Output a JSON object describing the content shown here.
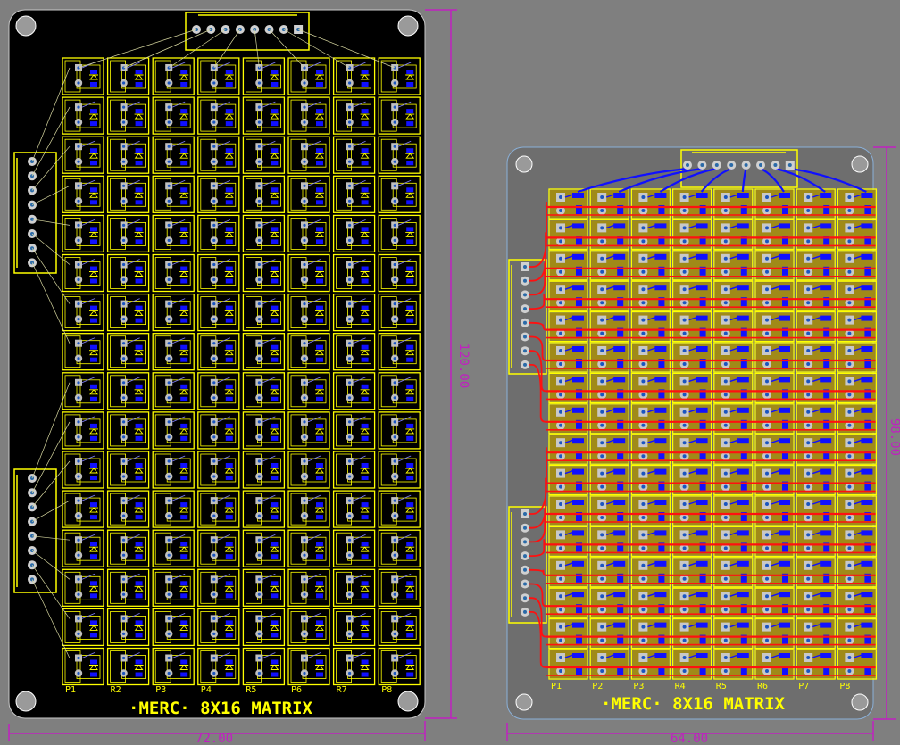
{
  "boards": [
    {
      "id": "left",
      "title": "·MERC· 8X16 MATRIX",
      "rows": 16,
      "cols": 8,
      "column_labels": [
        "P1",
        "R2",
        "P3",
        "P4",
        "R5",
        "P6",
        "R7",
        "P8"
      ],
      "width_dim_label": "72.00",
      "height_dim_label": "120.00",
      "view": "silkscreen + drill (routing hidden)"
    },
    {
      "id": "right",
      "title": "·MERC· 8X16 MATRIX",
      "rows": 16,
      "cols": 8,
      "column_labels": [
        "P1",
        "P2",
        "P3",
        "R4",
        "R5",
        "R6",
        "P7",
        "P8"
      ],
      "width_dim_label": "64.00",
      "height_dim_label": "98.00",
      "view": "top + bottom copper routed"
    }
  ],
  "colors": {
    "background": "#7f7f7f",
    "board_fill_left": "#000000",
    "board_fill_right": "#6e6e6e",
    "silkscreen": "#ffff00",
    "dimension": "#c020c0",
    "top_copper": "#ff1010",
    "bottom_copper": "#1010ff",
    "pad_copper": "#a08a18",
    "via": "#40c0c0",
    "outline": "#c8c8c8"
  }
}
